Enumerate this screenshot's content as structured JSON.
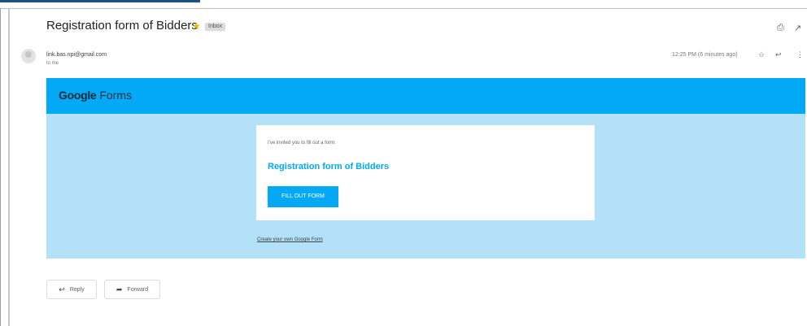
{
  "top_bar": {
    "text": ""
  },
  "email": {
    "subject": "Registration form of Bidders",
    "label_chip": "Inbox",
    "sender": "link.bas.npi@gmail.com",
    "recipient": "to me",
    "timestamp": "12:25 PM (6 minutes ago)"
  },
  "icons": {
    "star": "star-icon",
    "print": "print-icon",
    "new_window": "open-in-new-window-icon",
    "star_outline": "star-outline-icon",
    "reply": "reply-icon",
    "more": "more-vert-icon",
    "forward": "forward-icon"
  },
  "form_email": {
    "logo_google": "Google",
    "logo_forms": "Forms",
    "intro": "I've invited you to fill out a form:",
    "title": "Registration form of Bidders",
    "fill_button": "FILL OUT FORM",
    "create_link": "Create your own Google Form"
  },
  "actions": {
    "reply_label": "Reply",
    "forward_label": "Forward"
  },
  "colors": {
    "accent": "#03a9f4",
    "body_bg": "#b3e2f8",
    "star": "#f4b400"
  }
}
